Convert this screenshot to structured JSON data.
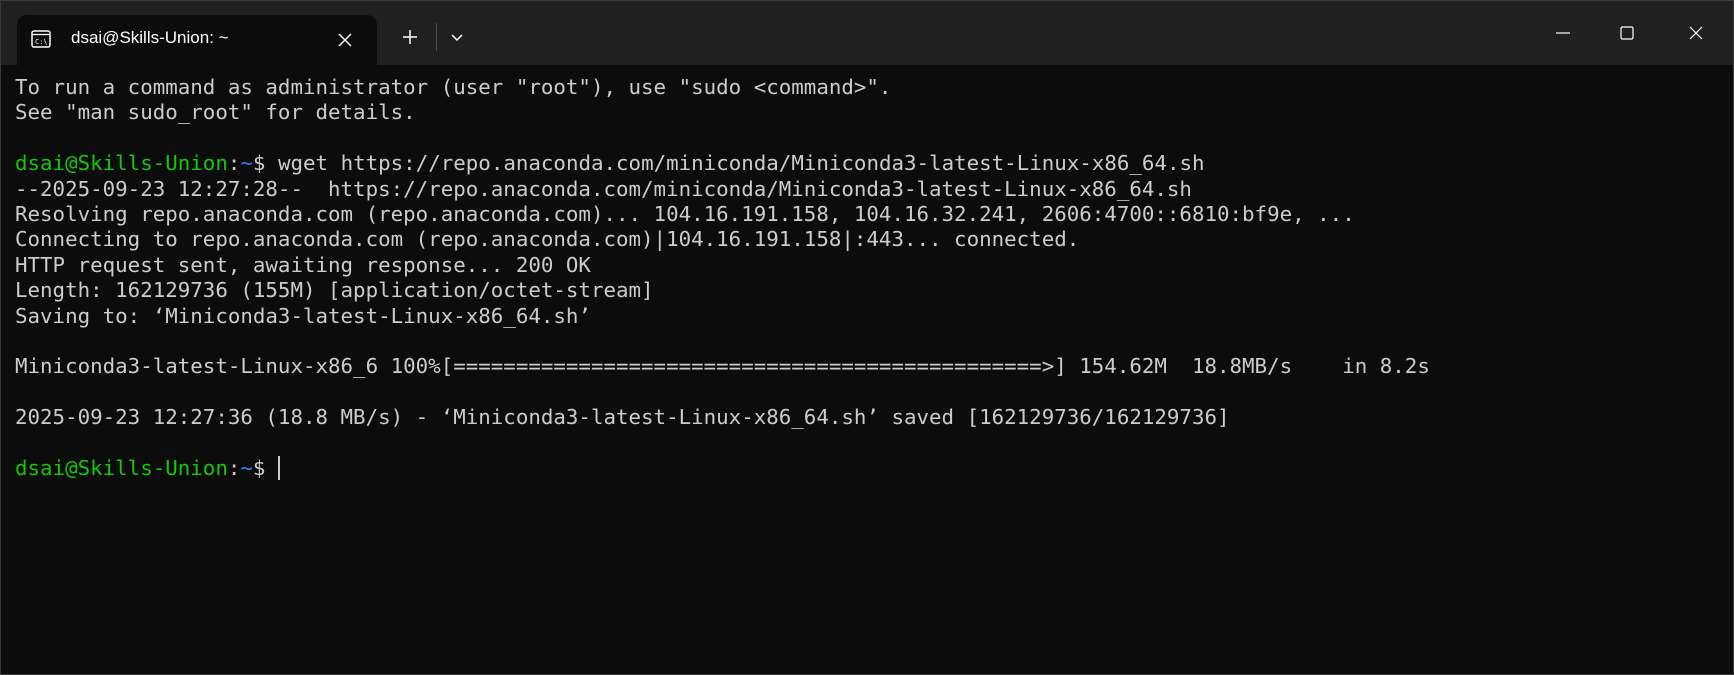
{
  "window": {
    "tab_title": "dsai@Skills-Union: ~",
    "icons": {
      "tab": "terminal-icon",
      "tab_close": "close-icon",
      "new_tab": "plus-icon",
      "dropdown": "chevron-down-icon",
      "minimize": "minimize-icon",
      "maximize": "maximize-icon",
      "close": "close-icon"
    }
  },
  "colors": {
    "background": "#0c0c0c",
    "titlebar": "#202020",
    "text": "#cccccc",
    "prompt_user": "#16c60c",
    "prompt_path": "#3b78ff"
  },
  "terminal": {
    "line1": "To run a command as administrator (user \"root\"), use \"sudo <command>\".",
    "line2": "See \"man sudo_root\" for details.",
    "prompt1": {
      "user": "dsai@Skills-Union",
      "colon": ":",
      "path": "~",
      "dollar": "$ ",
      "command": "wget https://repo.anaconda.com/miniconda/Miniconda3-latest-Linux-x86_64.sh"
    },
    "line4": "--2025-09-23 12:27:28--  https://repo.anaconda.com/miniconda/Miniconda3-latest-Linux-x86_64.sh",
    "line5": "Resolving repo.anaconda.com (repo.anaconda.com)... 104.16.191.158, 104.16.32.241, 2606:4700::6810:bf9e, ...",
    "line6": "Connecting to repo.anaconda.com (repo.anaconda.com)|104.16.191.158|:443... connected.",
    "line7": "HTTP request sent, awaiting response... 200 OK",
    "line8": "Length: 162129736 (155M) [application/octet-stream]",
    "line9": "Saving to: ‘Miniconda3-latest-Linux-x86_64.sh’",
    "progress": "Miniconda3-latest-Linux-x86_6 100%[===============================================>] 154.62M  18.8MB/s    in 8.2s",
    "saved": "2025-09-23 12:27:36 (18.8 MB/s) - ‘Miniconda3-latest-Linux-x86_64.sh’ saved [162129736/162129736]",
    "prompt2": {
      "user": "dsai@Skills-Union",
      "colon": ":",
      "path": "~",
      "dollar": "$"
    }
  }
}
